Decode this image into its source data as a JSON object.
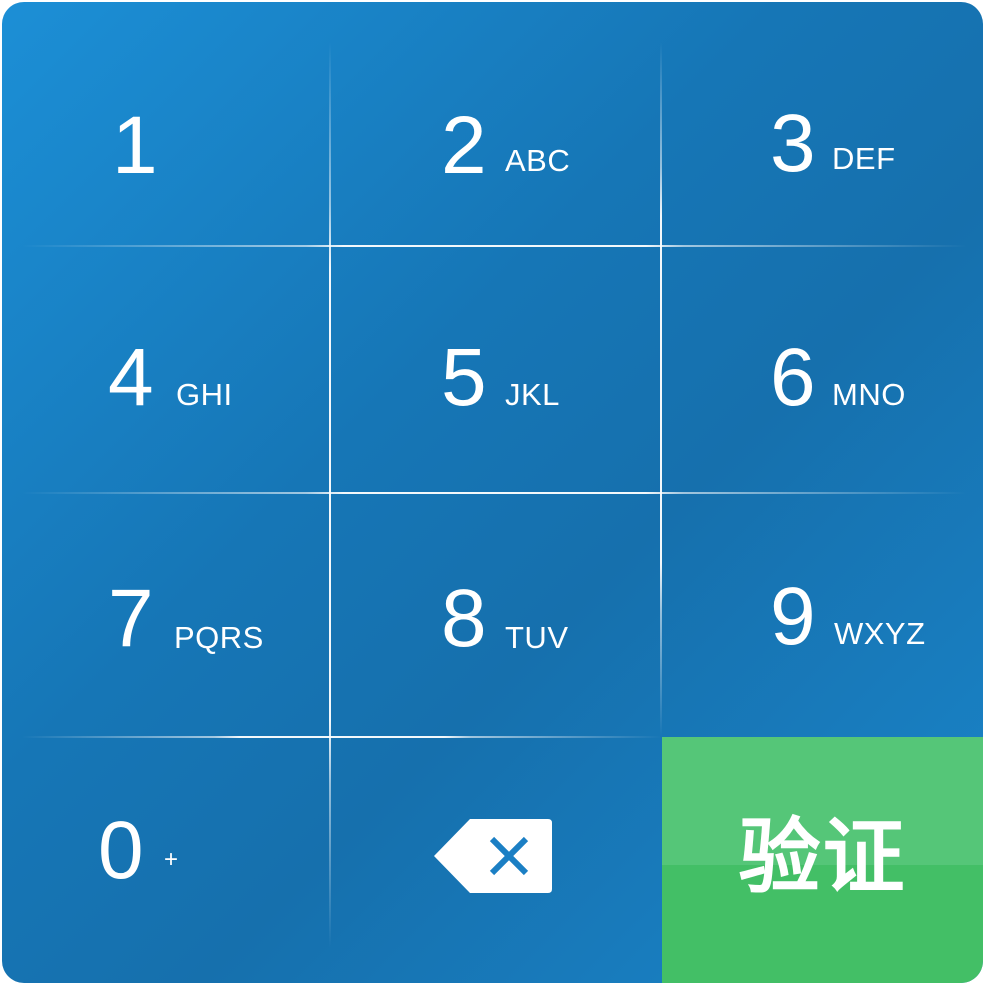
{
  "keypad": {
    "keys": [
      {
        "digit": "1",
        "letters": ""
      },
      {
        "digit": "2",
        "letters": "ABC"
      },
      {
        "digit": "3",
        "letters": "DEF"
      },
      {
        "digit": "4",
        "letters": "GHI"
      },
      {
        "digit": "5",
        "letters": "JKL"
      },
      {
        "digit": "6",
        "letters": "MNO"
      },
      {
        "digit": "7",
        "letters": "PQRS"
      },
      {
        "digit": "8",
        "letters": "TUV"
      },
      {
        "digit": "9",
        "letters": "WXYZ"
      },
      {
        "digit": "0",
        "letters": "+"
      }
    ],
    "backspace_icon": "backspace-icon",
    "verify_label": "验证"
  },
  "colors": {
    "keypad_blue": "#1a7fc2",
    "verify_green": "#4cc46f"
  }
}
